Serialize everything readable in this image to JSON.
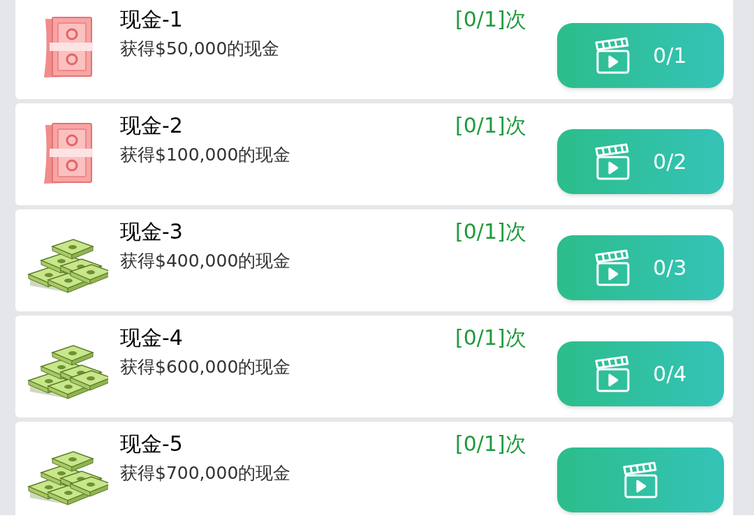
{
  "rewards": [
    {
      "kind": "bill",
      "title": "现金-1",
      "description": "获得$50,000的现金",
      "count": "[0/1]次",
      "button_label": "0/1"
    },
    {
      "kind": "bill",
      "title": "现金-2",
      "description": "获得$100,000的现金",
      "count": "[0/1]次",
      "button_label": "0/2"
    },
    {
      "kind": "stack",
      "title": "现金-3",
      "description": "获得$400,000的现金",
      "count": "[0/1]次",
      "button_label": "0/3"
    },
    {
      "kind": "stack",
      "title": "现金-4",
      "description": "获得$600,000的现金",
      "count": "[0/1]次",
      "button_label": "0/4"
    },
    {
      "kind": "stack",
      "title": "现金-5",
      "description": "获得$700,000的现金",
      "count": "[0/1]次"
    }
  ]
}
